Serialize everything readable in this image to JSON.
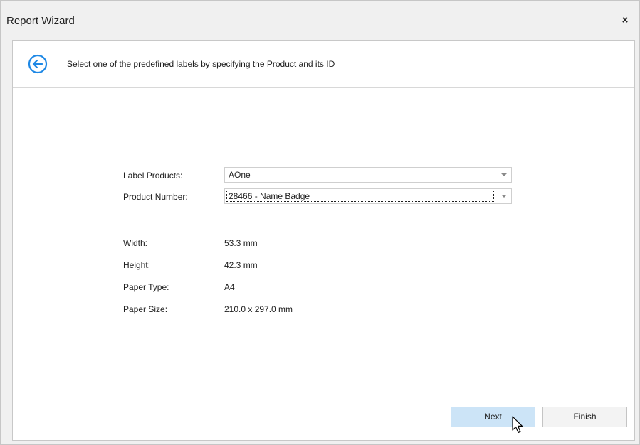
{
  "window": {
    "title": "Report Wizard",
    "close_icon": "close-icon",
    "close_glyph": "×"
  },
  "header": {
    "back_icon": "back-arrow-circle-icon",
    "instruction": "Select one of the predefined labels by specifying the Product and its ID"
  },
  "form": {
    "label_products": {
      "label": "Label Products:",
      "value": "AOne"
    },
    "product_number": {
      "label": "Product Number:",
      "value": "28466 - Name Badge"
    }
  },
  "details": {
    "width": {
      "label": "Width:",
      "value": "53.3 mm"
    },
    "height": {
      "label": "Height:",
      "value": "42.3 mm"
    },
    "paper_type": {
      "label": "Paper Type:",
      "value": "A4"
    },
    "paper_size": {
      "label": "Paper Size:",
      "value": "210.0 x 297.0 mm"
    }
  },
  "buttons": {
    "next": "Next",
    "finish": "Finish"
  },
  "colors": {
    "accent": "#1e88e5",
    "next_bg": "#cce4f7",
    "next_border": "#5a9bd5"
  }
}
